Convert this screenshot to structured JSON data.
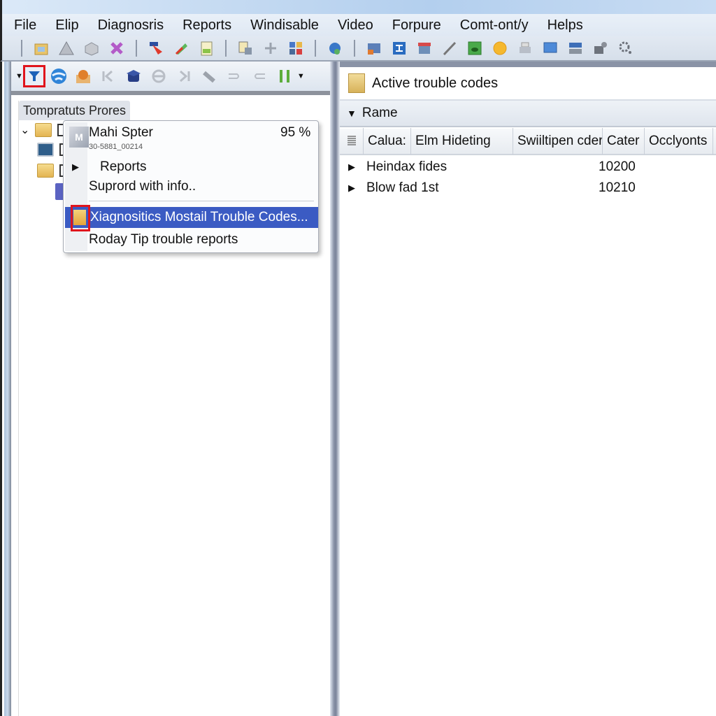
{
  "menu": [
    "File",
    "Elip",
    "Diagnosris",
    "Reports",
    "Windisable",
    "Video",
    "Forpure",
    "Comt-ont/y",
    "Helps"
  ],
  "toolbar1_icons": [
    "open-folder-icon",
    "triangle-tool-icon",
    "box-icon",
    "delete-x-icon",
    "cursor-arrow-icon",
    "pen-icon",
    "report-sheet-icon",
    "document-copy-icon",
    "plus-icon",
    "components-icon",
    "globe-lock-icon",
    "window-layout-icon",
    "network-icon",
    "store-icon",
    "pencil-icon",
    "green-chip-icon",
    "sun-icon",
    "printer-icon",
    "monitor-icon",
    "server-icon",
    "camera-gear-icon",
    "settings-gear-icon"
  ],
  "toolbar2_icons": [
    "filter-icon",
    "globe-icon",
    "package-icon",
    "first-icon",
    "graduation-icon",
    "circle-minus-icon",
    "last-icon",
    "ruler-icon",
    "merge-icon",
    "split-icon",
    "pause-icon"
  ],
  "tree": {
    "tab_label": "Tompratuts Prores"
  },
  "context_menu": {
    "header_title": "Mahi Spter",
    "header_subtitle": "30-5881_00214",
    "header_percent": "95 %",
    "items": [
      {
        "label": "Reports",
        "has_submenu": true
      },
      {
        "label": "Suprord with info.."
      },
      {
        "label": "Xiagnositics Mostail Trouble Codes...",
        "selected": true
      },
      {
        "label": "Roday Tip trouble reports"
      }
    ]
  },
  "right_pane": {
    "title": "Active trouble codes",
    "group_label": "Rame",
    "columns": [
      "Calua:",
      "Elm Hideting",
      "Swiiltipen cder",
      "Cater",
      "Occlyonts"
    ],
    "rows": [
      {
        "name": "Heindax fides",
        "code": "10200"
      },
      {
        "name": "Blow fad 1st",
        "code": "10210"
      }
    ]
  },
  "colors": {
    "selection": "#3b5bc3",
    "highlight_box": "#e0141c"
  }
}
